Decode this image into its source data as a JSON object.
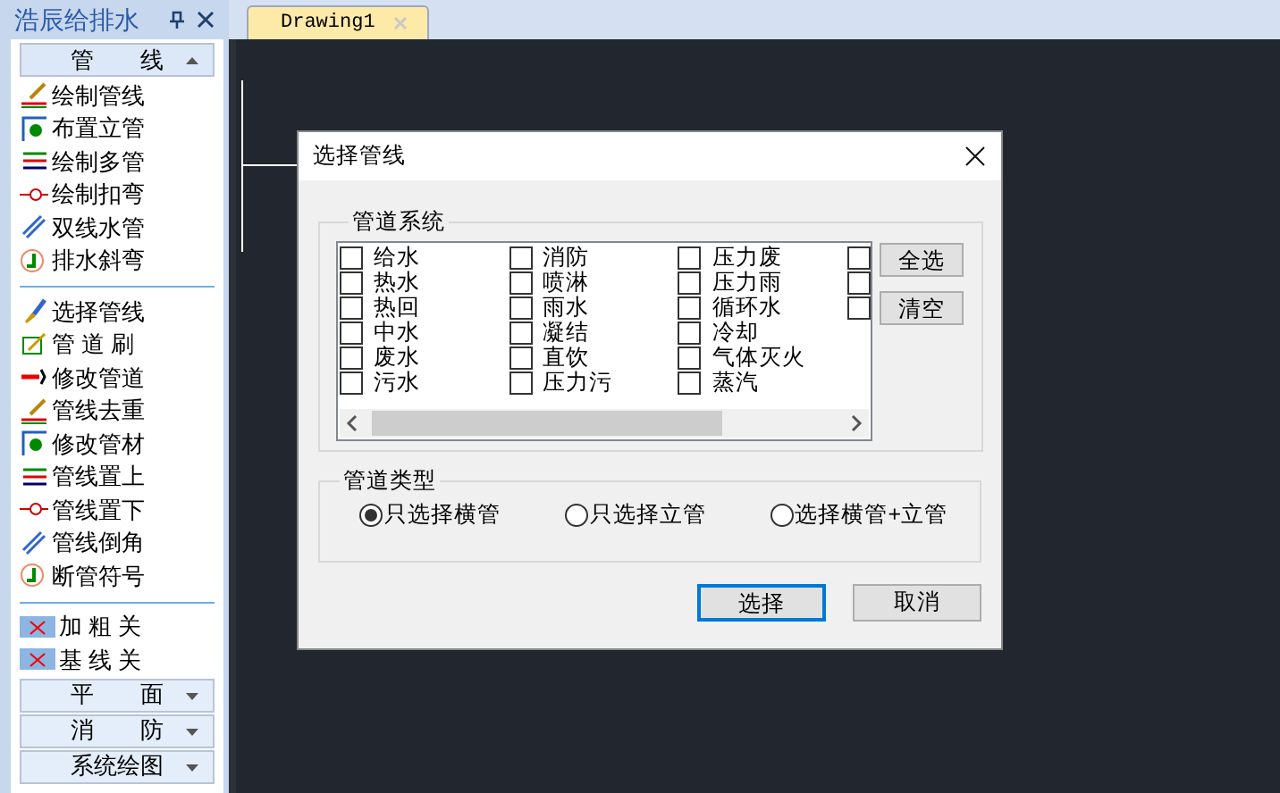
{
  "panel": {
    "title": "浩辰给排水"
  },
  "sections": [
    {
      "title": "管　　线",
      "expanded": true,
      "groups": [
        [
          "绘制管线",
          "布置立管",
          "绘制多管",
          "绘制扣弯",
          "双线水管",
          "排水斜弯"
        ],
        [
          "选择管线",
          "管 道 刷",
          "修改管道",
          "管线去重",
          "修改管材",
          "管线置上",
          "管线置下",
          "管线倒角",
          "断管符号"
        ],
        [
          "加 粗 关",
          "基 线 关"
        ]
      ]
    },
    {
      "title": "平　　面",
      "expanded": false
    },
    {
      "title": "消　　防",
      "expanded": false
    },
    {
      "title": "系统绘图",
      "expanded": false
    }
  ],
  "tabs": [
    {
      "label": "Drawing1",
      "selected": true
    }
  ],
  "dialog": {
    "title": "选择管线",
    "system_group": {
      "title": "管道系统",
      "columns": [
        [
          {
            "label": "给水",
            "checked": false
          },
          {
            "label": "热水",
            "checked": false
          },
          {
            "label": "热回",
            "checked": false
          },
          {
            "label": "中水",
            "checked": false
          },
          {
            "label": "废水",
            "checked": false
          },
          {
            "label": "污水",
            "checked": false
          }
        ],
        [
          {
            "label": "消防",
            "checked": false
          },
          {
            "label": "喷淋",
            "checked": false
          },
          {
            "label": "雨水",
            "checked": false
          },
          {
            "label": "凝结",
            "checked": false
          },
          {
            "label": "直饮",
            "checked": false
          },
          {
            "label": "压力污",
            "checked": false
          }
        ],
        [
          {
            "label": "压力废",
            "checked": false
          },
          {
            "label": "压力雨",
            "checked": false
          },
          {
            "label": "循环水",
            "checked": false
          },
          {
            "label": "冷却",
            "checked": false
          },
          {
            "label": "气体灭火",
            "checked": false
          },
          {
            "label": "蒸汽",
            "checked": false
          }
        ],
        [
          {
            "checked": false
          },
          {
            "checked": false
          },
          {
            "checked": false
          }
        ]
      ],
      "buttons": [
        "全选",
        "清空"
      ]
    },
    "type_group": {
      "title": "管道类型",
      "options": [
        {
          "label": "只选择横管",
          "selected": true
        },
        {
          "label": "只选择立管",
          "selected": false
        },
        {
          "label": "选择横管+立管",
          "selected": false
        }
      ]
    },
    "buttons": [
      {
        "label": "选择",
        "default": true
      },
      {
        "label": "取消",
        "default": false
      }
    ]
  }
}
